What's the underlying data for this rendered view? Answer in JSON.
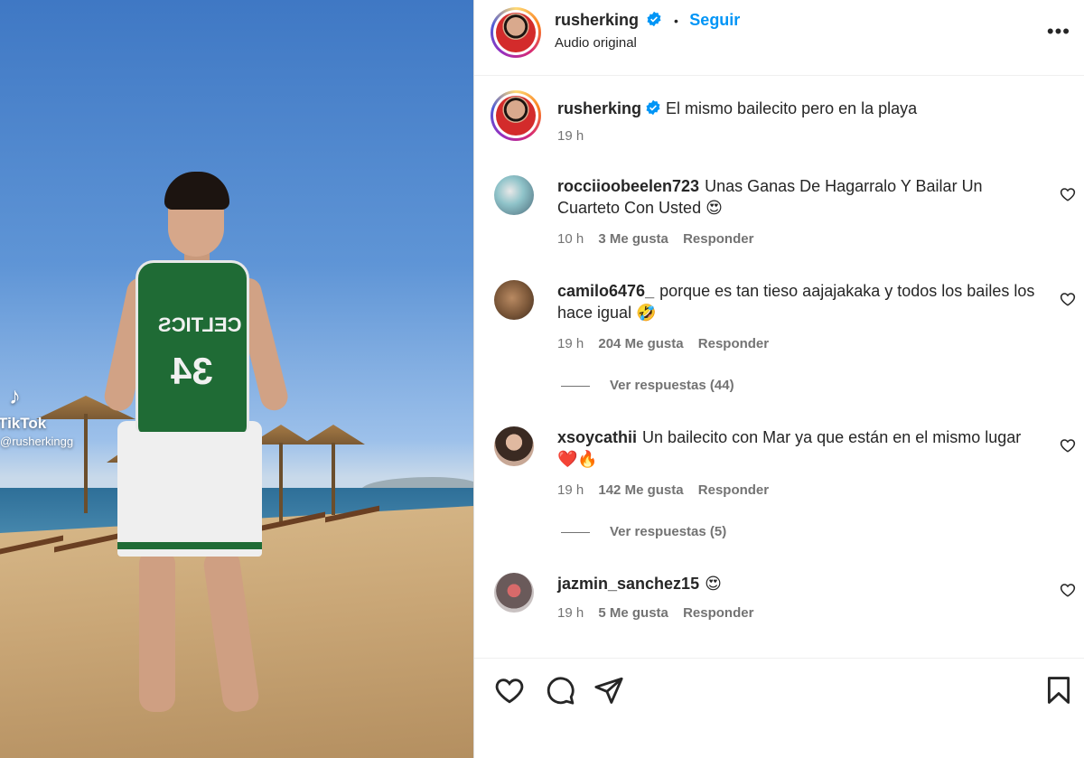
{
  "video": {
    "watermark_brand": "TikTok",
    "watermark_handle": "@rusherkingg",
    "jersey_text": "CELTICS",
    "jersey_number": "34"
  },
  "header": {
    "username": "rusherking",
    "separator": "•",
    "follow_label": "Seguir",
    "audio_label": "Audio original",
    "more_label": "•••"
  },
  "caption": {
    "username": "rusherking",
    "text": "El mismo bailecito pero en la playa",
    "time": "19 h"
  },
  "comments": [
    {
      "username": "rocciioobeelen723",
      "text": "Unas Ganas De Hagarralo Y Bailar Un Cuarteto Con Usted 😍",
      "time": "10 h",
      "likes": "3 Me gusta",
      "reply": "Responder",
      "view_replies": ""
    },
    {
      "username": "camilo6476_",
      "text": "porque es tan tieso aajajakaka y todos los bailes los hace igual 🤣",
      "time": "19 h",
      "likes": "204 Me gusta",
      "reply": "Responder",
      "view_replies": "Ver respuestas (44)"
    },
    {
      "username": "xsoycathii",
      "text": "Un bailecito con Mar ya que están en el mismo lugar ❤️🔥",
      "time": "19 h",
      "likes": "142 Me gusta",
      "reply": "Responder",
      "view_replies": "Ver respuestas (5)"
    },
    {
      "username": "jazmin_sanchez15",
      "text": "😍",
      "time": "19 h",
      "likes": "5 Me gusta",
      "reply": "Responder",
      "view_replies": ""
    }
  ],
  "icons": [
    "heart-icon",
    "comment-icon",
    "share-icon",
    "bookmark-icon",
    "verified-icon",
    "more-icon"
  ],
  "colors": {
    "link": "#0095f6",
    "muted": "#737373",
    "text": "#262626"
  }
}
